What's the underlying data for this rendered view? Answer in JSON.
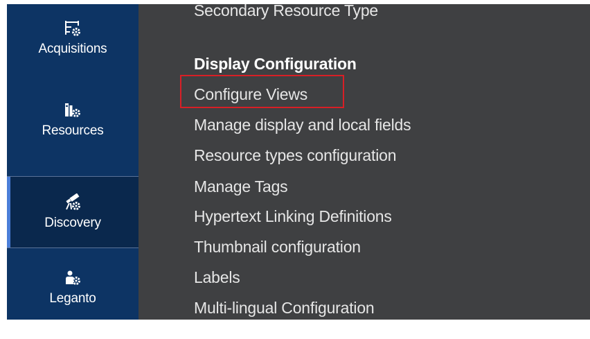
{
  "sidebar": {
    "items": [
      {
        "label": "Acquisitions",
        "icon": "acquisitions-gear-icon",
        "active": false
      },
      {
        "label": "Resources",
        "icon": "resources-gear-icon",
        "active": false
      },
      {
        "label": "Discovery",
        "icon": "discovery-telescope-gear-icon",
        "active": true
      },
      {
        "label": "Leganto",
        "icon": "leganto-gear-icon",
        "active": false
      }
    ]
  },
  "menu": {
    "partial_top_item": "Secondary Resource Type",
    "section_heading": "Display Configuration",
    "items": [
      "Configure Views",
      "Manage display and local fields",
      "Resource types configuration",
      "Manage Tags",
      "Hypertext Linking Definitions",
      "Thumbnail configuration",
      "Labels",
      "Multi-lingual Configuration"
    ]
  },
  "colors": {
    "sidebar_bg": "#0d3464",
    "sidebar_active_bg": "#0a284d",
    "active_indicator": "#4a7ed8",
    "menu_bg": "#3f4042",
    "highlight": "#d81f26"
  }
}
